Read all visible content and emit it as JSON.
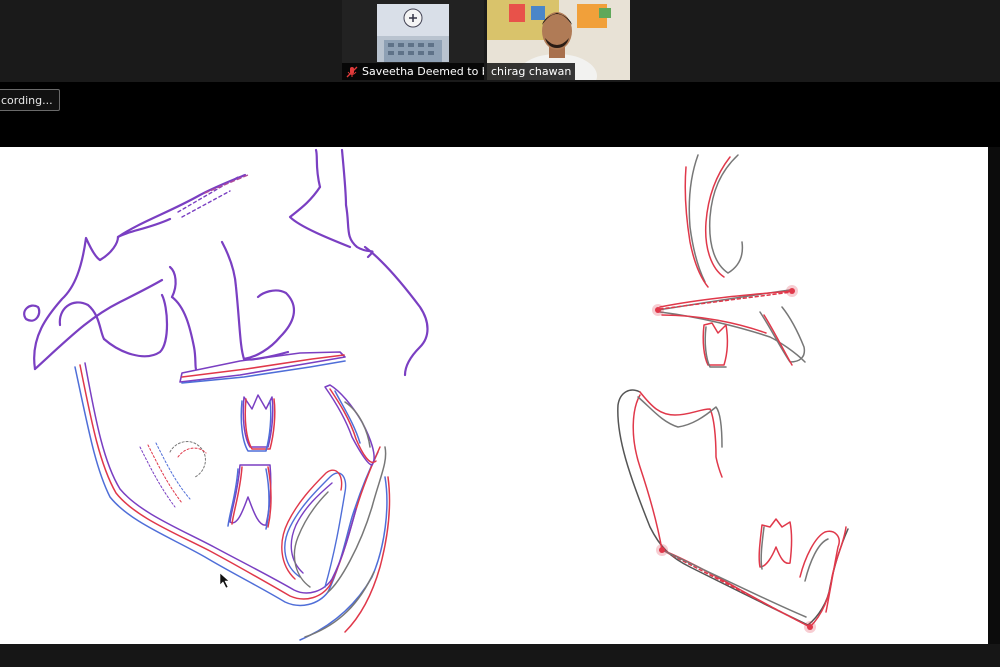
{
  "meeting": {
    "participants": [
      {
        "name": "Saveetha Deemed to b...",
        "muted": true
      },
      {
        "name": "chirag chawan",
        "muted": false
      }
    ],
    "recording_label": "cording..."
  },
  "shared_screen": {
    "content": "cephalometric tracing drawing",
    "colors": {
      "purple": "#7a3fc2",
      "red": "#e0384a",
      "blue": "#4f6ed8",
      "gray": "#777777"
    }
  }
}
